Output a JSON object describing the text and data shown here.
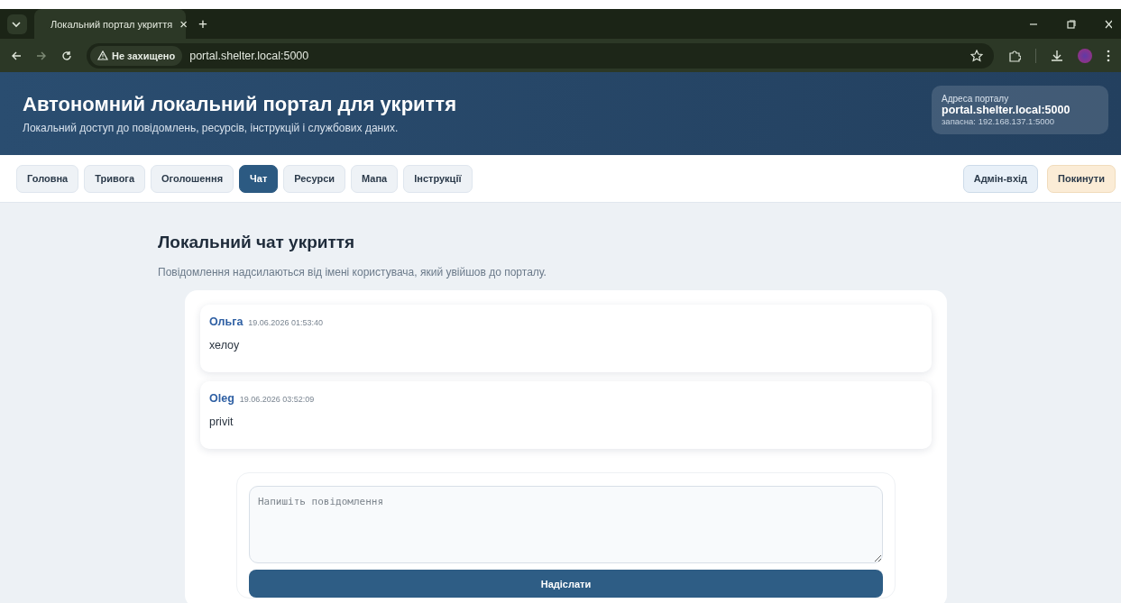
{
  "browser": {
    "tab_title": "Локальний портал укриття",
    "tab_close": "×",
    "new_tab": "+",
    "security": "Не захищено",
    "url": "portal.shelter.local:5000"
  },
  "header": {
    "title": "Автономний локальний портал для укриття",
    "subtitle": "Локальний доступ до повідомлень, ресурсів, інструкцій і службових даних.",
    "address_card": {
      "label": "Адреса порталу",
      "address": "portal.shelter.local:5000",
      "backup": "запасна: 192.168.137.1:5000"
    }
  },
  "nav": {
    "tabs": [
      {
        "label": "Головна",
        "selected": false
      },
      {
        "label": "Тривога",
        "selected": false
      },
      {
        "label": "Оголошення",
        "selected": false
      },
      {
        "label": "Чат",
        "selected": true
      },
      {
        "label": "Ресурси",
        "selected": false
      },
      {
        "label": "Мапа",
        "selected": false
      },
      {
        "label": "Інструкції",
        "selected": false
      }
    ],
    "actions": [
      {
        "label": "Адмін-вхід",
        "kind": "admin"
      },
      {
        "label": "Покинути",
        "kind": "leave"
      }
    ]
  },
  "page": {
    "title": "Локальний чат укриття",
    "description": "Повідомлення надсилаються від імені користувача, який увійшов до порталу."
  },
  "messages": [
    {
      "author": "Ольга",
      "time": "19.06.2026 01:53:40",
      "text": "хелоу"
    },
    {
      "author": "Oleg",
      "time": "19.06.2026 03:52:09",
      "text": "privit"
    }
  ],
  "composer": {
    "placeholder": "Напишіть повідомлення",
    "button": "Надіслати"
  }
}
